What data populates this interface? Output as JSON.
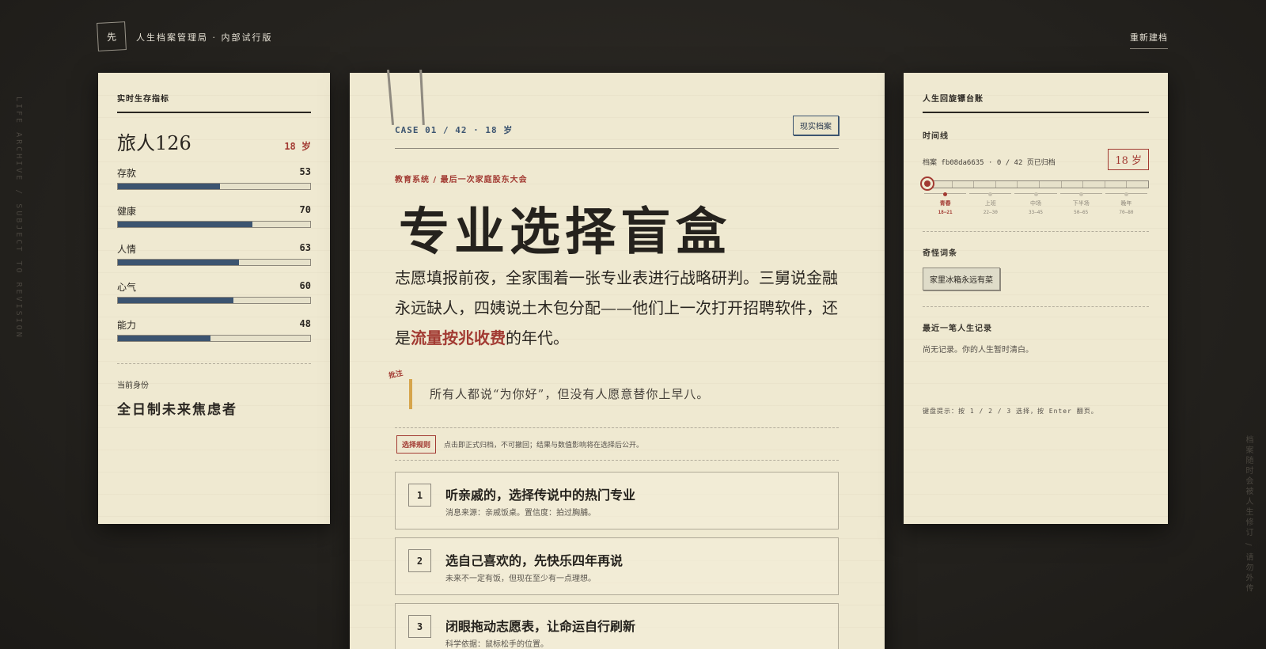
{
  "topbar": {
    "logo_char": "先",
    "brand": "人生档案管理局 · 内部试行版",
    "rebuild_label": "重新建档"
  },
  "side_left": "LIFE ARCHIVE / SUBJECT TO REVISION",
  "side_right": "档案随时会被人生修订 / 请勿外传",
  "left_panel": {
    "title": "实时生存指标",
    "player_name": "旅人126",
    "player_age": "18 岁",
    "stats": [
      {
        "label": "存款",
        "value": 53
      },
      {
        "label": "健康",
        "value": 70
      },
      {
        "label": "人情",
        "value": 63
      },
      {
        "label": "心气",
        "value": 60
      },
      {
        "label": "能力",
        "value": 48
      }
    ],
    "identity_label": "当前身份",
    "identity": "全日制未来焦虑者"
  },
  "case": {
    "id": "CASE 01 / 42 · 18 岁",
    "tag": "现实档案",
    "breadcrumb": "教育系统 / 最后一次家庭股东大会",
    "headline": "专业选择盲盒",
    "body_before": "志愿填报前夜，全家围着一张专业表进行战略研判。三舅说金融永远缺人，四姨说土木包分配——他们上一次打开招聘软件，还是",
    "body_highlight": "流量按兆收费",
    "body_after": "的年代。",
    "note_stamp": "批注",
    "quote": "所有人都说“为你好”，但没有人愿意替你上早八。",
    "rules_badge": "选择规则",
    "rules_text": "点击即正式归档，不可撤回；结果与数值影响将在选择后公开。",
    "choices": [
      {
        "num": "1",
        "title": "听亲戚的，选择传说中的热门专业",
        "sub": "消息来源：亲戚饭桌。置信度：拍过胸脯。"
      },
      {
        "num": "2",
        "title": "选自己喜欢的，先快乐四年再说",
        "sub": "未来不一定有饭，但现在至少有一点理想。"
      },
      {
        "num": "3",
        "title": "闭眼拖动志愿表，让命运自行刷新",
        "sub": "科学依据：鼠标松手的位置。"
      }
    ]
  },
  "right_panel": {
    "title": "人生回旋镖台账",
    "timeline_label": "时间线",
    "archive_text": "档案 fb08da6635 · 0 / 42 页已归档",
    "age_stamp": "18 岁",
    "timeline_progress": 0,
    "stages": [
      {
        "name": "青春",
        "range": "18–21",
        "active": true
      },
      {
        "name": "上班",
        "range": "22–30",
        "active": false
      },
      {
        "name": "中场",
        "range": "33–45",
        "active": false
      },
      {
        "name": "下半场",
        "range": "50–65",
        "active": false
      },
      {
        "name": "晚年",
        "range": "70–80",
        "active": false
      }
    ],
    "weird_label": "奇怪词条",
    "weird_word": "家里冰箱永远有菜",
    "record_label": "最近一笔人生记录",
    "record_empty": "尚无记录。你的人生暂时清白。",
    "kbd_hint": "键盘提示：按 1 / 2 / 3 选择，按 Enter 翻页。"
  },
  "colors": {
    "background": "#24221e",
    "paper": "#efe9d1",
    "accent_red": "#a23a32",
    "accent_blue": "#3c5470",
    "quote_bar": "#d6a54c"
  }
}
